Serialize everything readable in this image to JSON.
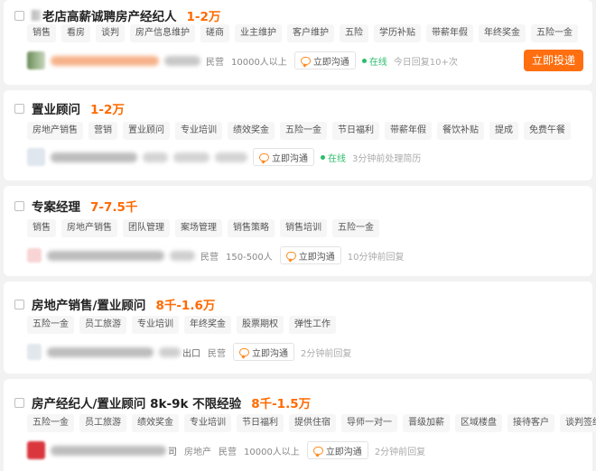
{
  "jobs": [
    {
      "title": "老店高薪诚聘房产经纪人",
      "salary": "1-2万",
      "tags": [
        "销售",
        "看房",
        "谈判",
        "房产信息维护",
        "磋商",
        "业主维护",
        "客户维护",
        "五险",
        "学历补贴",
        "带薪年假",
        "年终奖金",
        "五险一金"
      ],
      "company_type": "民营",
      "company_size": "10000人以上",
      "chat_label": "立即沟通",
      "online": "在线",
      "activity": "今日回复10+次",
      "apply_label": "立即投递"
    },
    {
      "title": "置业顾问",
      "salary": "1-2万",
      "tags": [
        "房地产销售",
        "营销",
        "置业顾问",
        "专业培训",
        "绩效奖金",
        "五险一金",
        "节日福利",
        "带薪年假",
        "餐饮补贴",
        "提成",
        "免费午餐"
      ],
      "chat_label": "立即沟通",
      "online": "在线",
      "activity": "3分钟前处理简历"
    },
    {
      "title": "专案经理",
      "salary": "7-7.5千",
      "tags": [
        "销售",
        "房地产销售",
        "团队管理",
        "案场管理",
        "销售策略",
        "销售培训",
        "五险一金"
      ],
      "company_type": "民营",
      "company_size": "150-500人",
      "chat_label": "立即沟通",
      "activity": "10分钟前回复"
    },
    {
      "title": "房地产销售/置业顾问",
      "salary": "8千-1.6万",
      "tags": [
        "五险一金",
        "员工旅游",
        "专业培训",
        "年终奖金",
        "股票期权",
        "弹性工作"
      ],
      "company_suffix": "出口",
      "company_type": "民营",
      "chat_label": "立即沟通",
      "activity": "2分钟前回复"
    },
    {
      "title": "房产经纪人/置业顾问 8k-9k 不限经验",
      "salary": "8千-1.5万",
      "tags": [
        "五险一金",
        "员工旅游",
        "绩效奖金",
        "专业培训",
        "节日福利",
        "提供住宿",
        "导师一对一",
        "晋级加薪",
        "区域楼盘",
        "接待客户",
        "谈判签约"
      ],
      "company_suffix": "司",
      "industry": "房地产",
      "company_type": "民营",
      "company_size": "10000人以上",
      "chat_label": "立即沟通",
      "activity": "2分钟前回复"
    }
  ],
  "colors": {
    "salary": "#ff6a00",
    "apply": "#ff6f0f",
    "online": "#2cbc6a"
  },
  "icons": {
    "chat": "chat-bubble-icon",
    "checkbox": "checkbox"
  }
}
